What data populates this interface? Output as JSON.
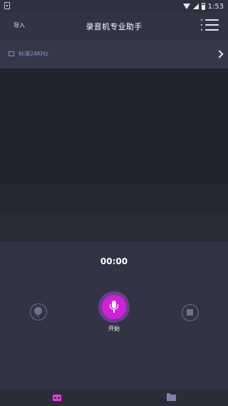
{
  "status_bar": {
    "time": "1:53"
  },
  "header": {
    "import_label": "导入",
    "title": "录音机专业助手"
  },
  "quality": {
    "label": "标清24KHz"
  },
  "recorder": {
    "timer": "00:00",
    "start_label": "开始"
  },
  "colors": {
    "accent": "#cf22d8",
    "background": "#2c2e3b",
    "waveform_bg": "#222430"
  },
  "icons": {
    "menu": "menu-icon",
    "mic": "mic-icon",
    "mark": "marker-icon",
    "stop": "stop-icon",
    "tab_record": "record-tab-icon",
    "tab_files": "folder-icon"
  }
}
